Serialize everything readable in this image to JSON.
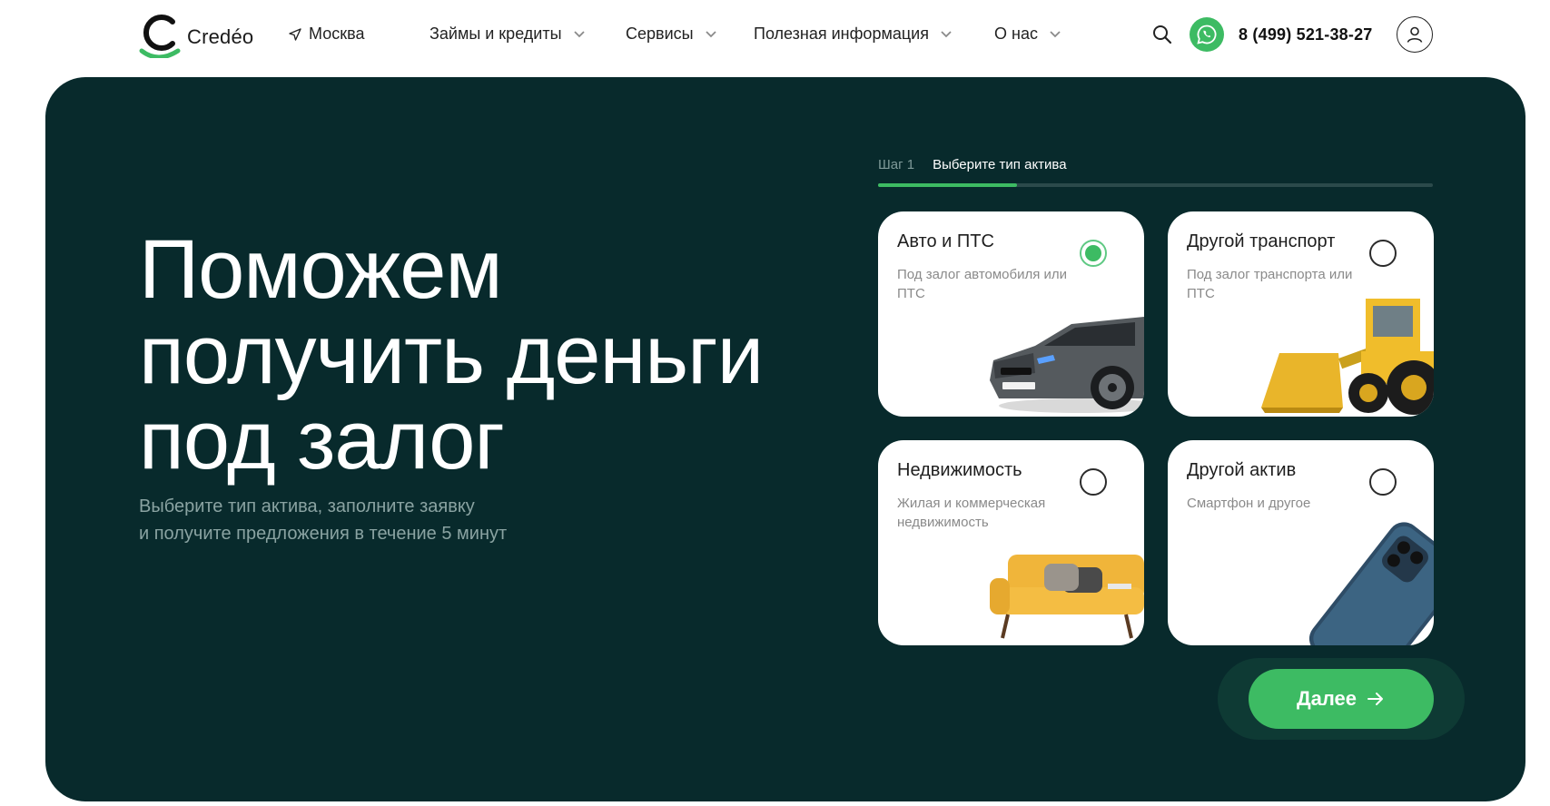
{
  "header": {
    "logo_text": "Credéo",
    "city": "Москва",
    "nav": [
      {
        "label": "Займы и кредиты"
      },
      {
        "label": "Сервисы"
      },
      {
        "label": "Полезная информация"
      },
      {
        "label": "О нас"
      }
    ],
    "phone": "8 (499) 521-38-27",
    "icons": {
      "search": "search-icon",
      "whatsapp": "whatsapp-icon",
      "account": "user-icon",
      "city": "location-arrow-icon",
      "chevron": "chevron-down-icon"
    }
  },
  "hero": {
    "title_lines": [
      "Поможем",
      "получить деньги",
      "под залог"
    ],
    "subtitle_lines": [
      "Выберите тип актива, заполните заявку",
      "и получите предложения в течение 5 минут"
    ],
    "step": {
      "number": "Шаг 1",
      "label": "Выберите тип актива",
      "progress": 0.25
    },
    "cards": [
      {
        "title": "Авто и ПТС",
        "desc": "Под залог автомобиля или ПТС",
        "selected": true,
        "image": "car-image"
      },
      {
        "title": "Другой транспорт",
        "desc": "Под залог транспорта или ПТС",
        "selected": false,
        "image": "loader-image"
      },
      {
        "title": "Недвижимость",
        "desc": "Жилая и коммерческая недвижимость",
        "selected": false,
        "image": "sofa-image"
      },
      {
        "title": "Другой актив",
        "desc": "Смартфон и другое",
        "selected": false,
        "image": "smartphone-image"
      }
    ],
    "next_label": "Далее"
  },
  "colors": {
    "accent": "#3dbb63",
    "hero_bg": "#082a2c",
    "muted": "#8aa3a2"
  }
}
